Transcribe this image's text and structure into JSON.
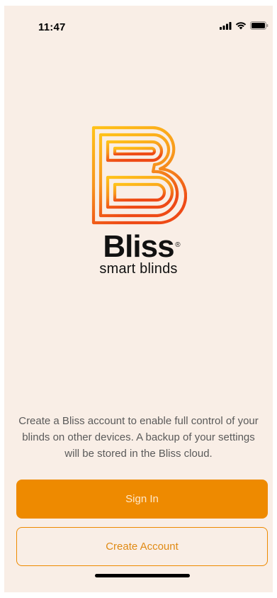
{
  "status_bar": {
    "time": "11:47",
    "icons": [
      "signal-icon",
      "wifi-icon",
      "battery-icon"
    ]
  },
  "brand": {
    "name": "Bliss",
    "registered_mark": "®",
    "tagline": "smart blinds",
    "logo_icon": "bliss-b-logo-icon",
    "gradient_colors": [
      "#ffc21a",
      "#f7941d",
      "#ee4a16"
    ]
  },
  "description": "Create a Bliss account to enable full control of your blinds on other devices. A backup of your settings will be stored in the Bliss cloud.",
  "buttons": {
    "sign_in": "Sign In",
    "create_account": "Create Account"
  },
  "colors": {
    "background": "#f9eee6",
    "accent": "#ee8a00"
  }
}
